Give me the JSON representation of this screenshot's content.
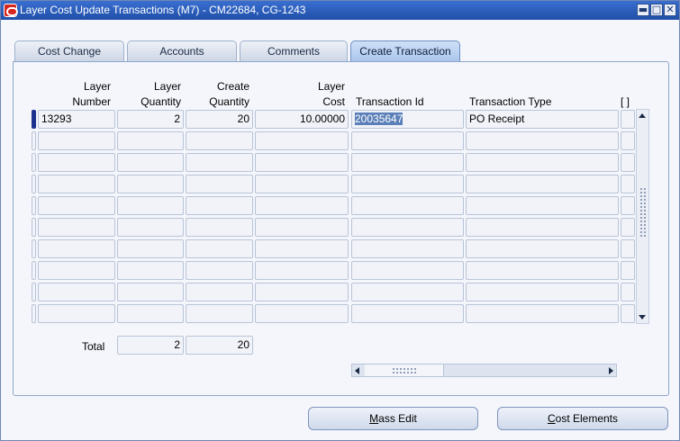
{
  "window": {
    "title": "Layer Cost Update Transactions (M7) - CM22684, CG-1243",
    "minimize_glyph": "▬",
    "maximize_glyph": "□",
    "close_glyph": "✕"
  },
  "tabs": [
    {
      "label": "Cost Change",
      "active": false
    },
    {
      "label": "Accounts",
      "active": false
    },
    {
      "label": "Comments",
      "active": false
    },
    {
      "label": "Create Transaction",
      "active": true
    }
  ],
  "table": {
    "headers": {
      "layer_number": [
        "Layer",
        "Number"
      ],
      "layer_quantity": [
        "Layer",
        "Quantity"
      ],
      "create_quantity": [
        "Create",
        "Quantity"
      ],
      "layer_cost": [
        "Layer",
        "Cost"
      ],
      "transaction_id": "Transaction Id",
      "transaction_type": "Transaction Type",
      "flex": "[ ]"
    },
    "rows": [
      {
        "layer_number": "13293",
        "layer_quantity": "2",
        "create_quantity": "20",
        "layer_cost": "10.00000",
        "transaction_id": "20035647",
        "transaction_type": "PO Receipt"
      }
    ],
    "visible_row_count": 10
  },
  "totals": {
    "label": "Total",
    "layer_quantity": "2",
    "create_quantity": "20"
  },
  "buttons": {
    "mass_edit_mnemonic": "M",
    "mass_edit_rest": "ass Edit",
    "cost_elements_mnemonic": "C",
    "cost_elements_rest": "ost Elements"
  },
  "icons": {
    "app": "oracle-app-icon",
    "minimize": "minimize-icon",
    "maximize": "maximize-icon",
    "close": "close-icon"
  }
}
